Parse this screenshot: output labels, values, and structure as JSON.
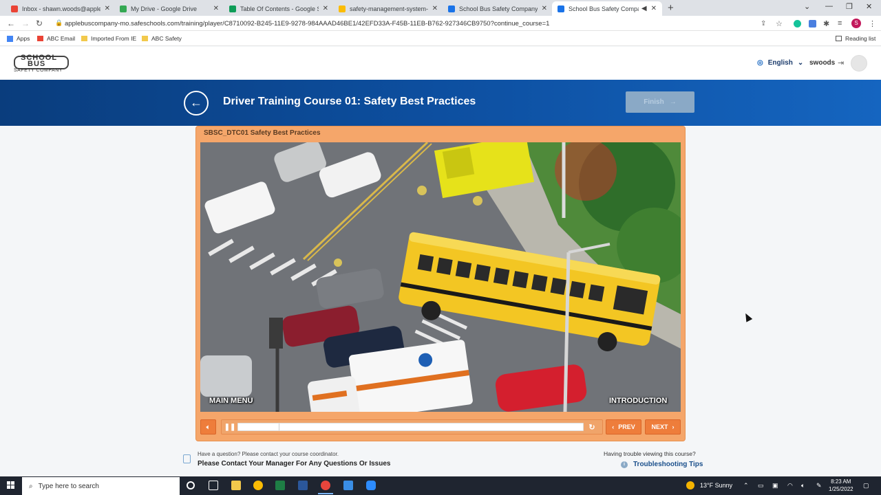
{
  "browser": {
    "tabs": [
      {
        "title": "Inbox - shawn.woods@applebus",
        "icon_color": "#ea4335",
        "icon": "gmail-icon"
      },
      {
        "title": "My Drive - Google Drive",
        "icon_color": "#34a853",
        "icon": "drive-icon"
      },
      {
        "title": "Table Of Contents - Google Shee",
        "icon_color": "#0f9d58",
        "icon": "sheets-icon"
      },
      {
        "title": "safety-management-system-pos",
        "icon_color": "#fbbc04",
        "icon": "drive-icon"
      },
      {
        "title": "School Bus Safety Company - Ad",
        "icon_color": "#1a73e8",
        "icon": "site-icon"
      },
      {
        "title": "School Bus Safety Company",
        "icon_color": "#1a73e8",
        "icon": "site-icon",
        "active": true
      }
    ],
    "new_tab": "+",
    "url": "applebuscompany-mo.safeschools.com/training/player/C8710092-B245-11E9-9278-984AAAD46BE1/42EFD33A-F45B-11EB-B762-927346CB9750?continue_course=1",
    "profile_initial": "S",
    "bookmarks": [
      {
        "label": "Apps",
        "icon": "apps-grid-icon",
        "color": "#4285f4"
      },
      {
        "label": "ABC Email",
        "icon": "gmail-icon",
        "color": "#ea4335"
      },
      {
        "label": "Imported From IE",
        "icon": "folder-icon",
        "color": "#f2c94c"
      },
      {
        "label": "ABC Safety",
        "icon": "folder-icon",
        "color": "#f2c94c"
      }
    ],
    "reading_list": "Reading list"
  },
  "site": {
    "logo_line1": "SCHOOL",
    "logo_line2": "BUS",
    "logo_line3": "SAFETY COMPANY",
    "language": "English",
    "username": "swoods"
  },
  "course": {
    "title": "Driver Training Course 01: Safety Best Practices",
    "finish_label": "Finish",
    "module_label": "SBSC_DTC01 Safety Best Practices",
    "overlay_left": "MAIN MENU",
    "overlay_right": "INTRODUCTION",
    "prev_label": "PREV",
    "next_label": "NEXT",
    "progress": 0.12
  },
  "footer": {
    "question_small": "Have a question? Please contact your course coordinator.",
    "question_big": "Please Contact Your Manager For Any Questions Or Issues",
    "trouble_text": "Having trouble viewing this course?",
    "tips_label": "Troubleshooting Tips"
  },
  "taskbar": {
    "search_placeholder": "Type here to search",
    "weather": "13°F  Sunny",
    "time": "8:23 AM",
    "date": "1/25/2022"
  },
  "colors": {
    "brand_blue": "#0d4fa0",
    "player_orange": "#f5a66a",
    "button_orange": "#ee7d3b"
  }
}
